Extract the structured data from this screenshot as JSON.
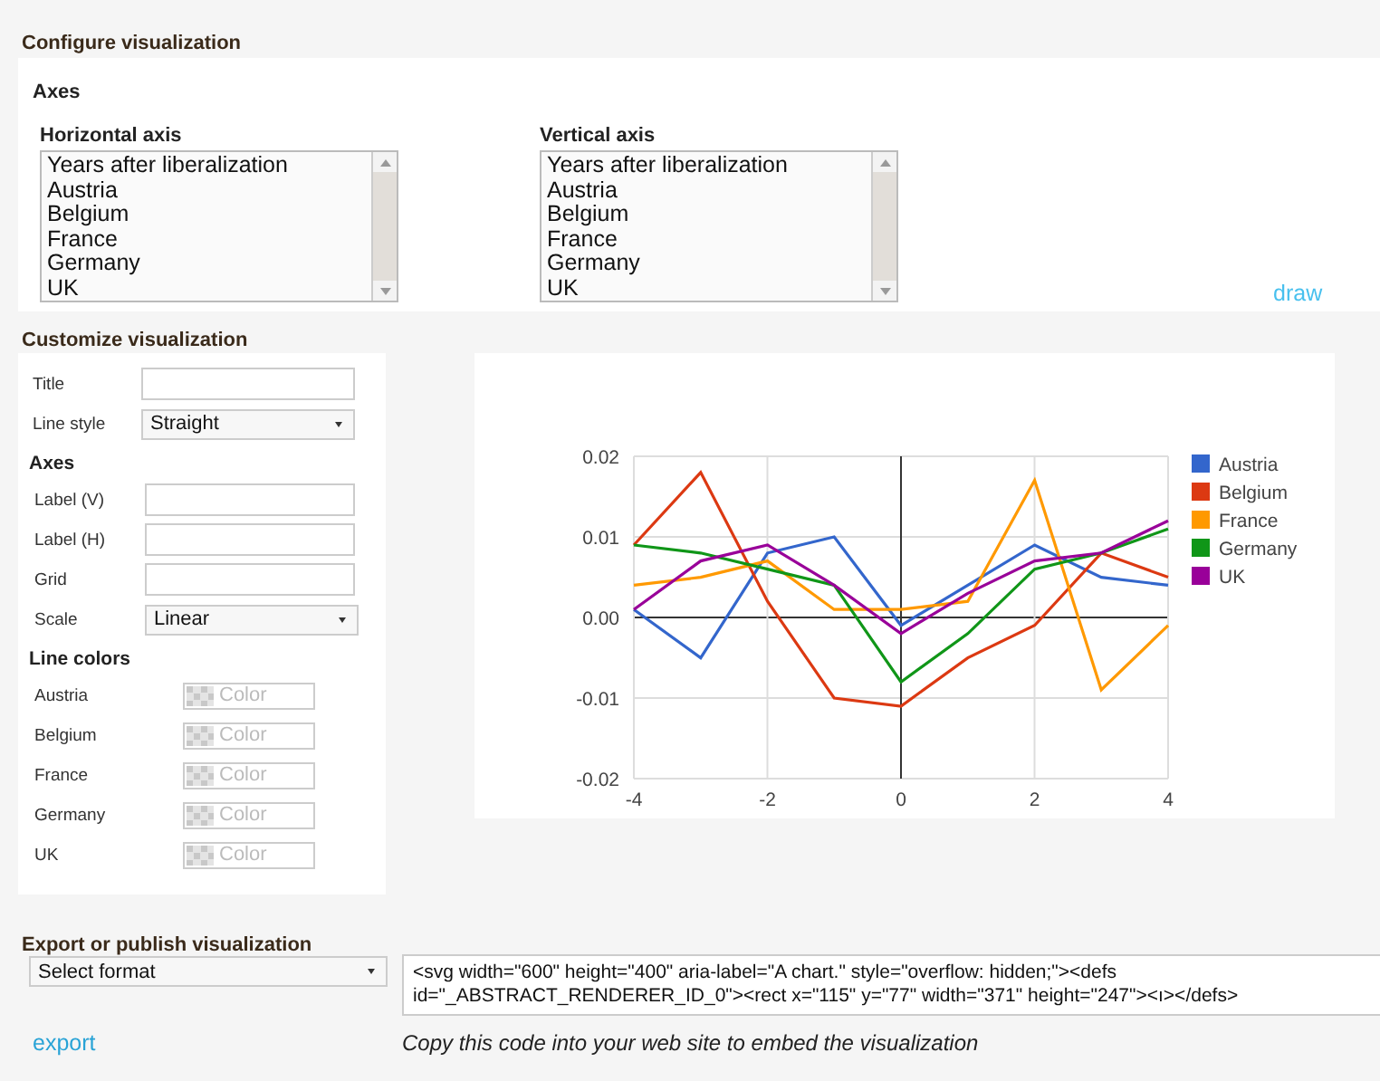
{
  "header": {
    "title": "Configure visualization"
  },
  "axes": {
    "heading": "Axes",
    "lists": [
      {
        "label": "Horizontal axis",
        "options": [
          {
            "text": "Years after liberalization",
            "selected": false
          },
          {
            "text": "Austria",
            "selected": false
          },
          {
            "text": "Belgium",
            "selected": false
          },
          {
            "text": "France",
            "selected": false
          },
          {
            "text": "Germany",
            "selected": false
          },
          {
            "text": "UK",
            "selected": false
          }
        ]
      },
      {
        "label": "Vertical axis",
        "options": [
          {
            "text": "Years after liberalization",
            "selected": false
          },
          {
            "text": "Austria",
            "selected": false
          },
          {
            "text": "Belgium",
            "selected": false
          },
          {
            "text": "France",
            "selected": false
          },
          {
            "text": "Germany",
            "selected": false
          },
          {
            "text": "UK",
            "selected": false
          }
        ]
      }
    ],
    "draw_link": "draw"
  },
  "customize": {
    "heading": "Customize visualization",
    "general_fields": [
      {
        "kind": "text",
        "label": "Title"
      },
      {
        "kind": "select",
        "label": "Line style",
        "value": "Straight"
      }
    ],
    "axes_heading": "Axes",
    "axes_fields": [
      {
        "kind": "text",
        "label": "Label (V)"
      },
      {
        "kind": "text",
        "label": "Label (H)"
      },
      {
        "kind": "text",
        "label": "Grid"
      },
      {
        "kind": "select",
        "label": "Scale",
        "value": "Linear"
      }
    ],
    "colors_heading": "Line colors",
    "line_colors": [
      {
        "label": "Austria",
        "placeholder": "Color"
      },
      {
        "label": "Belgium",
        "placeholder": "Color"
      },
      {
        "label": "France",
        "placeholder": "Color"
      },
      {
        "label": "Germany",
        "placeholder": "Color"
      },
      {
        "label": "UK",
        "placeholder": "Color"
      }
    ]
  },
  "chart": {
    "chart_data": {
      "type": "line",
      "grid": true,
      "legend": "right",
      "x": [
        -4,
        -3,
        -2,
        -1,
        0,
        1,
        2,
        3,
        4
      ],
      "xlim": [
        -4,
        4
      ],
      "ylim": [
        -0.02,
        0.02
      ],
      "xticks": [
        -4,
        -2,
        0,
        2,
        4
      ],
      "yticks": [
        {
          "value": -0.02,
          "label": "-0.02"
        },
        {
          "value": -0.01,
          "label": "-0.01"
        },
        {
          "value": 0,
          "label": "0.00"
        },
        {
          "value": 0.01,
          "label": "0.01"
        },
        {
          "value": 0.02,
          "label": "0.02"
        }
      ],
      "series": [
        {
          "name": "Austria",
          "color": "#3366cc",
          "values": [
            0.001,
            -0.005,
            0.008,
            0.01,
            -0.001,
            0.004,
            0.009,
            0.005,
            0.004
          ]
        },
        {
          "name": "Belgium",
          "color": "#dc3912",
          "values": [
            0.009,
            0.018,
            0.002,
            -0.01,
            -0.011,
            -0.005,
            -0.001,
            0.008,
            0.005
          ]
        },
        {
          "name": "France",
          "color": "#ff9900",
          "values": [
            0.004,
            0.005,
            0.007,
            0.001,
            0.001,
            0.002,
            0.017,
            -0.009,
            -0.001
          ]
        },
        {
          "name": "Germany",
          "color": "#109618",
          "values": [
            0.009,
            0.008,
            0.006,
            0.004,
            -0.008,
            -0.002,
            0.006,
            0.008,
            0.011
          ]
        },
        {
          "name": "UK",
          "color": "#990099",
          "values": [
            0.001,
            0.007,
            0.009,
            0.004,
            -0.002,
            0.003,
            0.007,
            0.008,
            0.012
          ]
        }
      ]
    }
  },
  "export": {
    "heading": "Export or publish visualization",
    "format_select": "Select format",
    "code_lines": [
      "<svg width=\"600\" height=\"400\" aria-label=\"A chart.\" style=\"overflow: hidden;\"><defs",
      "id=\"_ABSTRACT_RENDERER_ID_0\"><rect x=\"115\" y=\"77\" width=\"371\" height=\"247\"><ı></defs>"
    ],
    "export_link": "export",
    "hint": "Copy this code into your web site to embed the visualization"
  }
}
